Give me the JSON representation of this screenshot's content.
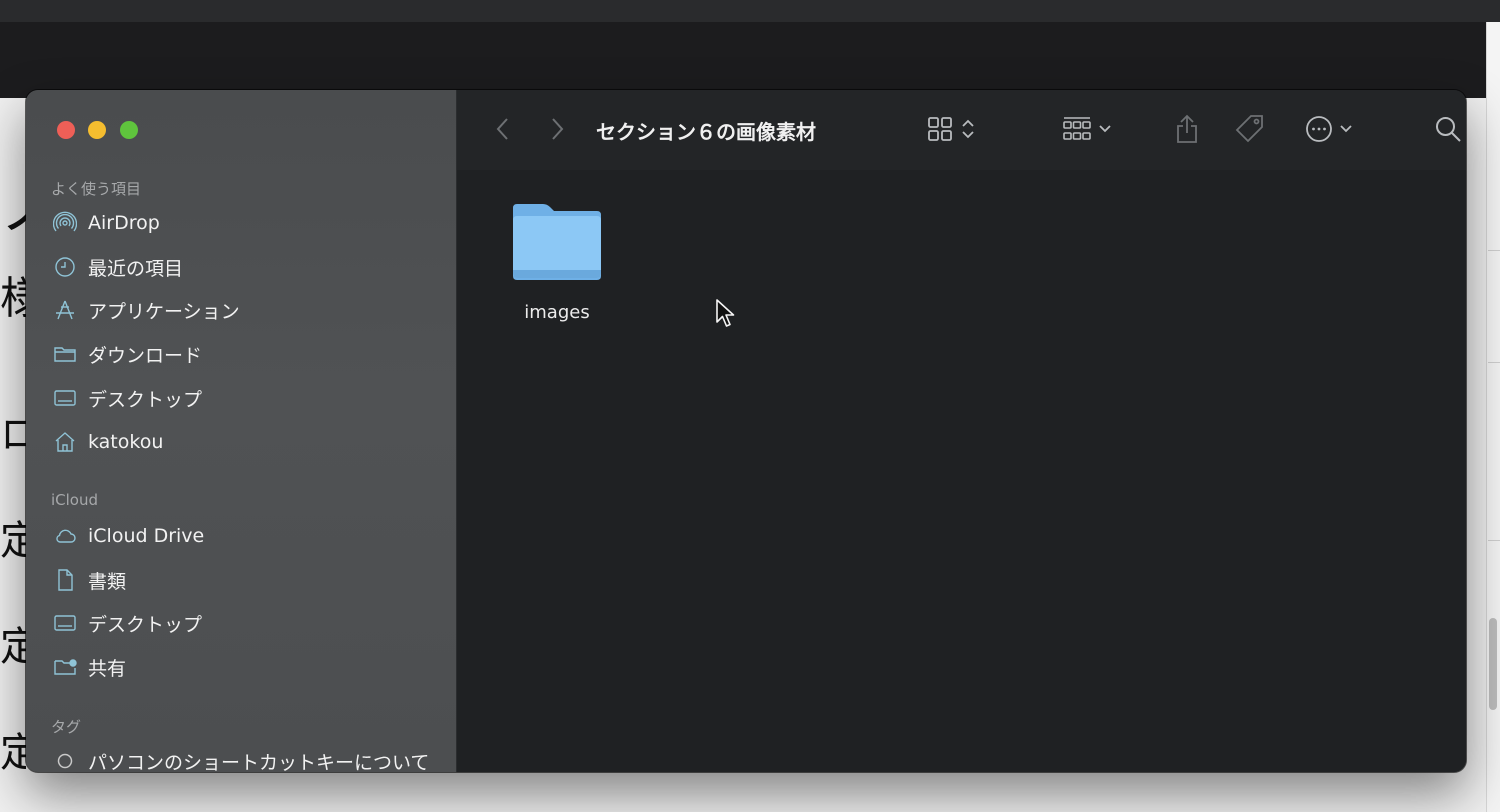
{
  "window": {
    "title": "セクション６の画像素材"
  },
  "sidebar": {
    "sections": [
      {
        "header": "よく使う項目",
        "items": [
          {
            "label": "AirDrop",
            "icon": "airdrop-icon"
          },
          {
            "label": "最近の項目",
            "icon": "clock-icon"
          },
          {
            "label": "アプリケーション",
            "icon": "applications-icon"
          },
          {
            "label": "ダウンロード",
            "icon": "folder-icon"
          },
          {
            "label": "デスクトップ",
            "icon": "desktop-icon"
          },
          {
            "label": "katokou",
            "icon": "home-icon"
          }
        ]
      },
      {
        "header": "iCloud",
        "items": [
          {
            "label": "iCloud Drive",
            "icon": "cloud-icon"
          },
          {
            "label": "書類",
            "icon": "document-icon"
          },
          {
            "label": "デスクトップ",
            "icon": "desktop-icon"
          },
          {
            "label": "共有",
            "icon": "shared-folder-icon"
          }
        ]
      },
      {
        "header": "タグ",
        "items": [
          {
            "label": "パソコンのショートカットキーについて",
            "icon": "tag-circle-icon"
          }
        ]
      }
    ]
  },
  "content": {
    "items": [
      {
        "name": "images",
        "icon": "folder-icon"
      }
    ]
  },
  "background": {
    "glyphs": [
      "ノ",
      "様",
      "ロ",
      "定",
      "定",
      "定"
    ]
  },
  "colors": {
    "folder": "#8cc8f5",
    "close": "#ee5f57",
    "minimize": "#f5bd2f",
    "maximize": "#5fc43d"
  }
}
